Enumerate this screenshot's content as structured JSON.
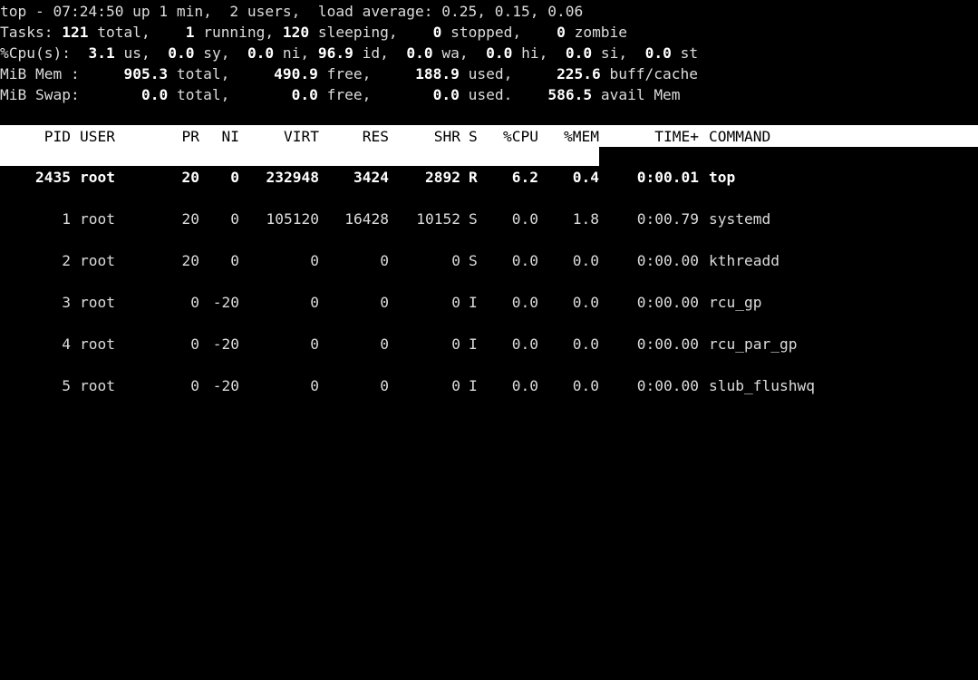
{
  "summary": {
    "line1": "top - 07:24:50 up 1 min,  2 users,  load average: 0.25, 0.15, 0.06",
    "tasks": {
      "label": "Tasks:",
      "total": "121",
      "total_label": " total,",
      "running": "1",
      "running_label": " running,",
      "sleeping": "120",
      "sleeping_label": " sleeping,",
      "stopped": "0",
      "stopped_label": " stopped,",
      "zombie": "0",
      "zombie_label": " zombie"
    },
    "cpu": {
      "label": "%Cpu(s):",
      "us": "3.1",
      "us_label": " us,",
      "sy": "0.0",
      "sy_label": " sy,",
      "ni": "0.0",
      "ni_label": " ni,",
      "id": "96.9",
      "id_label": " id,",
      "wa": "0.0",
      "wa_label": " wa,",
      "hi": "0.0",
      "hi_label": " hi,",
      "si": "0.0",
      "si_label": " si,",
      "st": "0.0",
      "st_label": " st"
    },
    "mem": {
      "label": "MiB Mem :",
      "total": "905.3",
      "total_label": " total,",
      "free": "490.9",
      "free_label": " free,",
      "used": "188.9",
      "used_label": " used,",
      "buff": "225.6",
      "buff_label": " buff/cache"
    },
    "swap": {
      "label": "MiB Swap:",
      "total": "0.0",
      "total_label": " total,",
      "free": "0.0",
      "free_label": " free,",
      "used": "0.0",
      "used_label": " used.",
      "avail": "586.5",
      "avail_label": " avail Mem"
    }
  },
  "columns": {
    "pid": "PID",
    "user": "USER",
    "pr": "PR",
    "ni": "NI",
    "virt": "VIRT",
    "res": "RES",
    "shr": "SHR",
    "s": "S",
    "cpu": "%CPU",
    "mem": "%MEM",
    "time": "TIME+",
    "command": "COMMAND"
  },
  "processes": [
    {
      "pid": "2435",
      "user": "root",
      "pr": "20",
      "ni": "0",
      "virt": "232948",
      "res": "3424",
      "shr": "2892",
      "s": "R",
      "cpu": "6.2",
      "mem": "0.4",
      "time": "0:00.01",
      "command": "top"
    },
    {
      "pid": "1",
      "user": "root",
      "pr": "20",
      "ni": "0",
      "virt": "105120",
      "res": "16428",
      "shr": "10152",
      "s": "S",
      "cpu": "0.0",
      "mem": "1.8",
      "time": "0:00.79",
      "command": "systemd"
    },
    {
      "pid": "2",
      "user": "root",
      "pr": "20",
      "ni": "0",
      "virt": "0",
      "res": "0",
      "shr": "0",
      "s": "S",
      "cpu": "0.0",
      "mem": "0.0",
      "time": "0:00.00",
      "command": "kthreadd"
    },
    {
      "pid": "3",
      "user": "root",
      "pr": "0",
      "ni": "-20",
      "virt": "0",
      "res": "0",
      "shr": "0",
      "s": "I",
      "cpu": "0.0",
      "mem": "0.0",
      "time": "0:00.00",
      "command": "rcu_gp"
    },
    {
      "pid": "4",
      "user": "root",
      "pr": "0",
      "ni": "-20",
      "virt": "0",
      "res": "0",
      "shr": "0",
      "s": "I",
      "cpu": "0.0",
      "mem": "0.0",
      "time": "0:00.00",
      "command": "rcu_par_gp"
    },
    {
      "pid": "5",
      "user": "root",
      "pr": "0",
      "ni": "-20",
      "virt": "0",
      "res": "0",
      "shr": "0",
      "s": "I",
      "cpu": "0.0",
      "mem": "0.0",
      "time": "0:00.00",
      "command": "slub_flushwq"
    }
  ],
  "colors": {
    "background": "#000000",
    "text": "#dcdcdc",
    "highlight_text": "#ffffff",
    "header_bg": "#ffffff",
    "header_text": "#000000"
  }
}
